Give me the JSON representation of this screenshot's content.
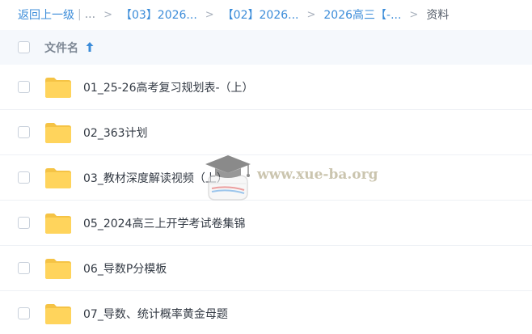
{
  "breadcrumb": {
    "back_label": "返回上一级",
    "pipe": "|",
    "ellipsis": "...",
    "separator": ">",
    "crumbs": [
      "【03】2026...",
      "【02】2026...",
      "2026高三【-..."
    ],
    "current": "资料"
  },
  "list_header": {
    "name_label": "文件名",
    "sort": "ascending"
  },
  "files": [
    {
      "name": "01_25-26高考复习规划表-（上）",
      "type": "folder"
    },
    {
      "name": "02_363计划",
      "type": "folder"
    },
    {
      "name": "03_教材深度解读视频（上）",
      "type": "folder"
    },
    {
      "name": "05_2024高三上开学考试卷集锦",
      "type": "folder"
    },
    {
      "name": "06_导数P分模板",
      "type": "folder"
    },
    {
      "name": "07_导数、统计概率黄金母题",
      "type": "folder"
    }
  ],
  "watermark": {
    "text": "www.xue-ba.org",
    "icon": "graduation-cap-book-icon"
  },
  "colors": {
    "link": "#3b8cd9",
    "header_bg": "#f5f8fc",
    "folder": "#ffd45c",
    "text": "#333a44"
  }
}
